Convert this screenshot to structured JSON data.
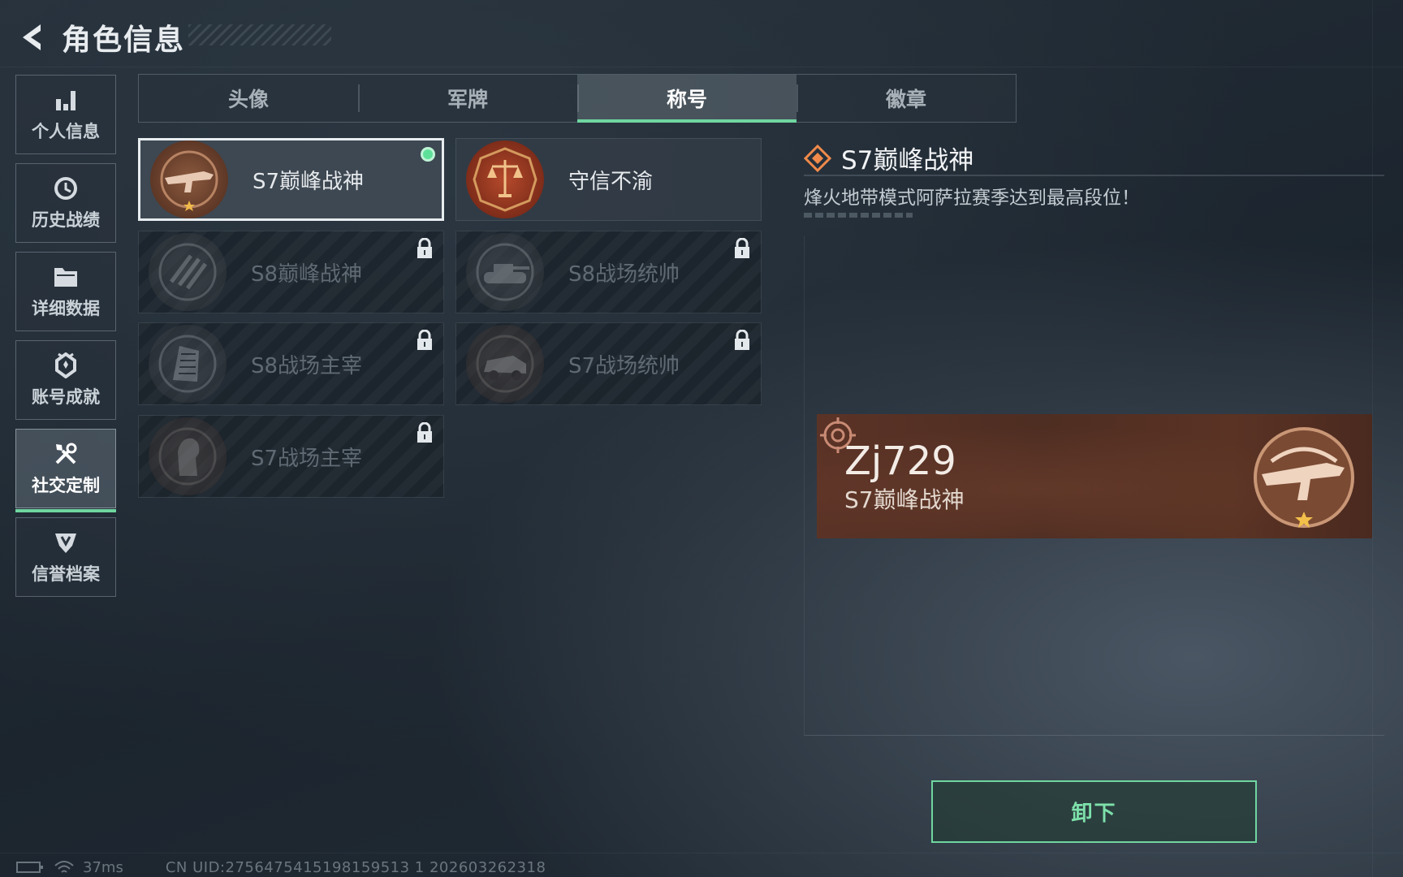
{
  "header": {
    "title": "角色信息"
  },
  "sidebar": {
    "items": [
      {
        "label": "个人信息",
        "icon": "bar-chart-icon",
        "active": false
      },
      {
        "label": "历史战绩",
        "icon": "history-clock-icon",
        "active": false
      },
      {
        "label": "详细数据",
        "icon": "folder-icon",
        "active": false
      },
      {
        "label": "账号成就",
        "icon": "achievement-badge-icon",
        "active": false
      },
      {
        "label": "社交定制",
        "icon": "tools-icon",
        "active": true
      },
      {
        "label": "信誉档案",
        "icon": "shield-wing-icon",
        "active": false
      }
    ]
  },
  "tabs": [
    {
      "label": "头像",
      "active": false
    },
    {
      "label": "军牌",
      "active": false
    },
    {
      "label": "称号",
      "active": true
    },
    {
      "label": "徽章",
      "active": false
    }
  ],
  "titles": [
    {
      "label": "S7巅峰战神",
      "locked": false,
      "selected": true,
      "equipped": true,
      "medal": "rifle-medal-icon"
    },
    {
      "label": "守信不渝",
      "locked": false,
      "selected": false,
      "equipped": false,
      "medal": "scales-medal-icon"
    },
    {
      "label": "S8巅峰战神",
      "locked": true,
      "selected": false,
      "equipped": false,
      "medal": "stripes-medal-icon"
    },
    {
      "label": "S8战场统帅",
      "locked": true,
      "selected": false,
      "equipped": false,
      "medal": "tank-medal-icon"
    },
    {
      "label": "S8战场主宰",
      "locked": true,
      "selected": false,
      "equipped": false,
      "medal": "building-medal-icon"
    },
    {
      "label": "S7战场统帅",
      "locked": true,
      "selected": false,
      "equipped": false,
      "medal": "vehicle-medal-icon"
    },
    {
      "label": "S7战场主宰",
      "locked": true,
      "selected": false,
      "equipped": false,
      "medal": "soldier-medal-icon"
    }
  ],
  "detail": {
    "title": "S7巅峰战神",
    "description": "烽火地带模式阿萨拉赛季达到最高段位！"
  },
  "nameplate": {
    "player_name": "Zj729",
    "title": "S7巅峰战神"
  },
  "actions": {
    "unequip_label": "卸下"
  },
  "status": {
    "ping": "37ms",
    "uid": "CN UID:2756475415198159513 1 202603262318"
  },
  "colors": {
    "accent_green": "#6fd6a0",
    "equipped_dot": "#5fe09a",
    "nameplate_bg": "#5b3326",
    "medal_bronze": "#a0613f"
  }
}
